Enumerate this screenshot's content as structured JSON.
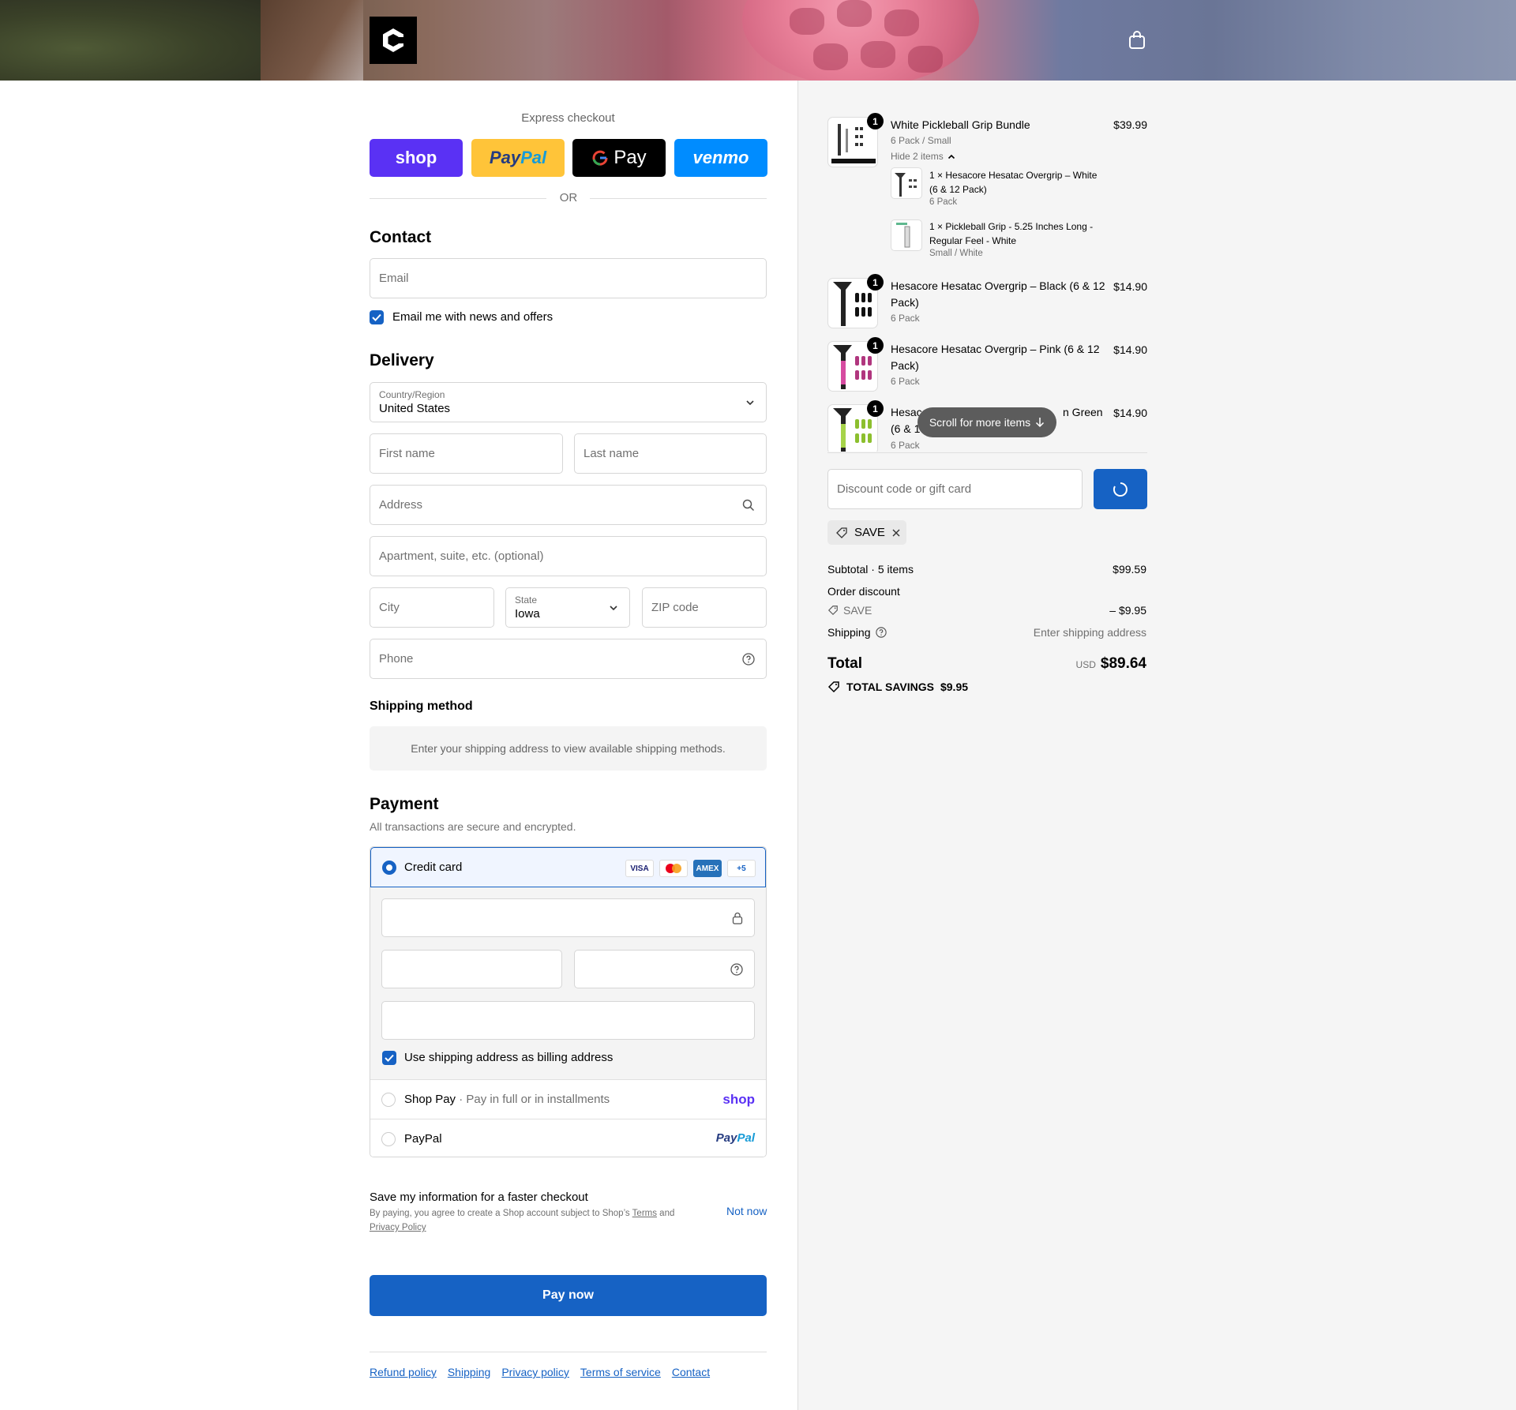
{
  "express": {
    "title": "Express checkout",
    "shop": "shop",
    "paypal_a": "Pay",
    "paypal_b": "Pal",
    "gpay": "Pay",
    "venmo": "venmo",
    "or": "OR"
  },
  "contact": {
    "heading": "Contact",
    "email_placeholder": "Email",
    "news_label": "Email me with news and offers",
    "news_checked": true
  },
  "delivery": {
    "heading": "Delivery",
    "country_label": "Country/Region",
    "country_value": "United States",
    "first_name": "First name",
    "last_name": "Last name",
    "address": "Address",
    "apartment": "Apartment, suite, etc. (optional)",
    "city": "City",
    "state_label": "State",
    "state_value": "Iowa",
    "zip": "ZIP code",
    "phone": "Phone"
  },
  "shipping_method": {
    "heading": "Shipping method",
    "message": "Enter your shipping address to view available shipping methods."
  },
  "payment": {
    "heading": "Payment",
    "subtitle": "All transactions are secure and encrypted.",
    "credit_card": "Credit card",
    "badges": [
      "VISA",
      "",
      "AMEX",
      "+5"
    ],
    "billing_label": "Use shipping address as billing address",
    "shop_pay": "Shop Pay",
    "shop_pay_sub": "Pay in full or in installments",
    "shop_pay_logo": "shop",
    "paypal": "PayPal",
    "paypal_logo_a": "Pay",
    "paypal_logo_b": "Pal"
  },
  "save_info": {
    "title": "Save my information for a faster checkout",
    "legal_prefix": "By paying, you agree to create a Shop account subject to Shop’s ",
    "terms": "Terms",
    "and": " and ",
    "privacy": "Privacy Policy",
    "not_now": "Not now"
  },
  "pay_now": "Pay now",
  "footer": [
    "Refund policy",
    "Shipping",
    "Privacy policy",
    "Terms of service",
    "Contact"
  ],
  "summary": {
    "items": [
      {
        "name": "White Pickleball Grip Bundle",
        "variant": "6 Pack / Small",
        "price": "$39.99",
        "qty": "1"
      },
      {
        "name": "Hesacore Hesatac Overgrip – Black (6 & 12 Pack)",
        "variant": "6 Pack",
        "price": "$14.90",
        "qty": "1"
      },
      {
        "name": "Hesacore Hesatac Overgrip – Pink (6 & 12 Pack)",
        "variant": "6 Pack",
        "price": "$14.90",
        "qty": "1"
      },
      {
        "name_a": "Hesac",
        "name_b": "n Green",
        "name_c": "(6 & 1",
        "variant": "6 Pack",
        "price": "$14.90",
        "qty": "1"
      }
    ],
    "hide_items": "Hide 2 items",
    "bundle_parts": [
      {
        "name": "1 × Hesacore Hesatac Overgrip – White (6 & 12 Pack)",
        "variant": "6 Pack"
      },
      {
        "name": "1 × Pickleball Grip - 5.25 Inches Long - Regular Feel - White",
        "variant": "Small / White"
      }
    ],
    "scroll_pill": "Scroll for more items",
    "discount_placeholder": "Discount code or gift card",
    "code": "SAVE",
    "subtotal_label": "Subtotal · 5 items",
    "subtotal": "$99.59",
    "order_discount": "Order discount",
    "discount_code": "SAVE",
    "discount_value": "– $9.95",
    "shipping_label": "Shipping",
    "shipping_value": "Enter shipping address",
    "total_label": "Total",
    "currency": "USD",
    "total": "$89.64",
    "savings_label": "TOTAL SAVINGS",
    "savings_value": "$9.95"
  },
  "colors": {
    "accent": "#1662c4",
    "shop": "#5a31f4",
    "paypal": "#ffc439",
    "venmo": "#008cff"
  }
}
